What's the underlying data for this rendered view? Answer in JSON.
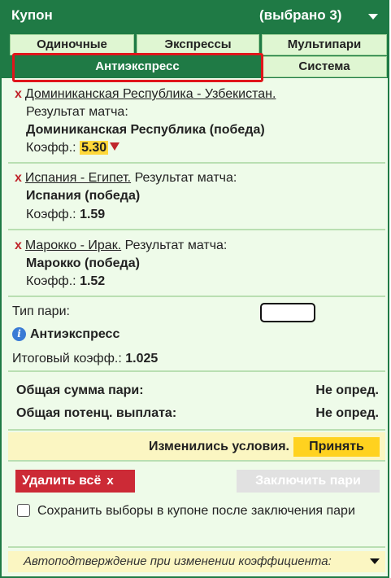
{
  "header": {
    "title": "Купон",
    "selected_count": "(выбрано 3)"
  },
  "tabs": [
    {
      "label": "Одиночные",
      "active": false
    },
    {
      "label": "Экспрессы",
      "active": false
    },
    {
      "label": "Мультипари",
      "active": false
    },
    {
      "label": "Антиэкспресс",
      "active": true
    },
    {
      "label": "Система",
      "active": false
    }
  ],
  "selections": [
    {
      "event": "Доминиканская Республика - Узбекистан.",
      "market": "Результат матча:",
      "pick": "Доминиканская Республика (победа)",
      "odds_label": "Коэфф.:",
      "odds": "5.30",
      "odds_changed": "down"
    },
    {
      "event": "Испания - Египет.",
      "market": "Результат матча:",
      "pick": "Испания (победа)",
      "odds_label": "Коэфф.:",
      "odds": "1.59"
    },
    {
      "event": "Марокко - Ирак.",
      "market": "Результат матча:",
      "pick": "Марокко (победа)",
      "odds_label": "Коэфф.:",
      "odds": "1.52"
    }
  ],
  "bet_type": {
    "label": "Тип пари:",
    "stake_value": "",
    "name": "Антиэкспресс",
    "total_odds_label": "Итоговый коэфф.:",
    "total_odds": "1.025"
  },
  "totals": {
    "stake_label": "Общая сумма пари:",
    "stake_value": "Не опред.",
    "payout_label": "Общая потенц. выплата:",
    "payout_value": "Не опред."
  },
  "notice": {
    "message": "Изменились условия.",
    "accept_label": "Принять"
  },
  "actions": {
    "delete_all_label": "Удалить всё",
    "delete_x": "x",
    "place_bet_label": "Заключить пари",
    "keep_selections_label": "Сохранить выборы в купоне после заключения пари",
    "keep_selections_checked": false
  },
  "auto_confirm": {
    "label": "Автоподтверждение при изменении коэффициента:"
  },
  "colors": {
    "primary": "#1f7a45",
    "panel": "#eefbe9",
    "tab": "#dff6d2",
    "danger": "#cc2a36",
    "accent": "#ffd21f",
    "highlight_frame": "#e0161b"
  },
  "icons": {
    "remove": "close-x-icon",
    "info": "info-icon",
    "odds_down": "triangle-down-icon",
    "dropdown": "chevron-down-icon"
  }
}
